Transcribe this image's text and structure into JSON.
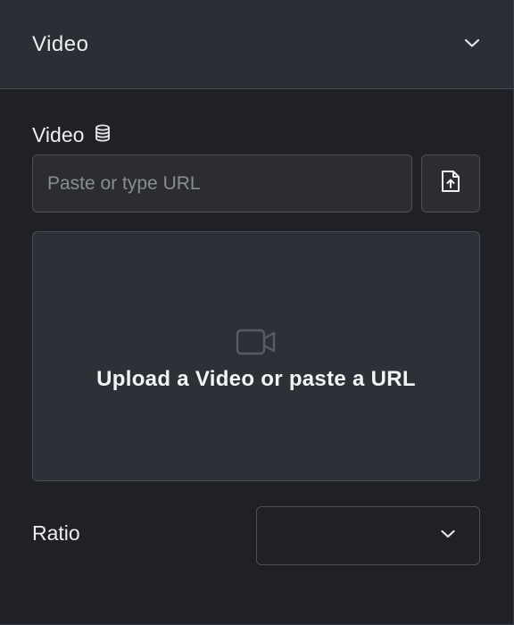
{
  "header": {
    "title": "Video"
  },
  "video_field": {
    "label": "Video",
    "input_value": "",
    "placeholder": "Paste or type URL"
  },
  "dropzone": {
    "text": "Upload a Video or paste a URL"
  },
  "ratio": {
    "label": "Ratio",
    "selected": ""
  },
  "icons": {
    "collapse": "chevron-down-icon",
    "dynamic_data": "database-icon",
    "upload": "file-upload-icon",
    "video": "video-camera-icon",
    "select": "chevron-down-icon"
  },
  "colors": {
    "header_bg": "#2c2e35",
    "body_bg": "#202126",
    "field_bg": "#2b2d33",
    "border": "#4e5058",
    "text": "#ecedf0",
    "placeholder": "#8a8c94"
  }
}
